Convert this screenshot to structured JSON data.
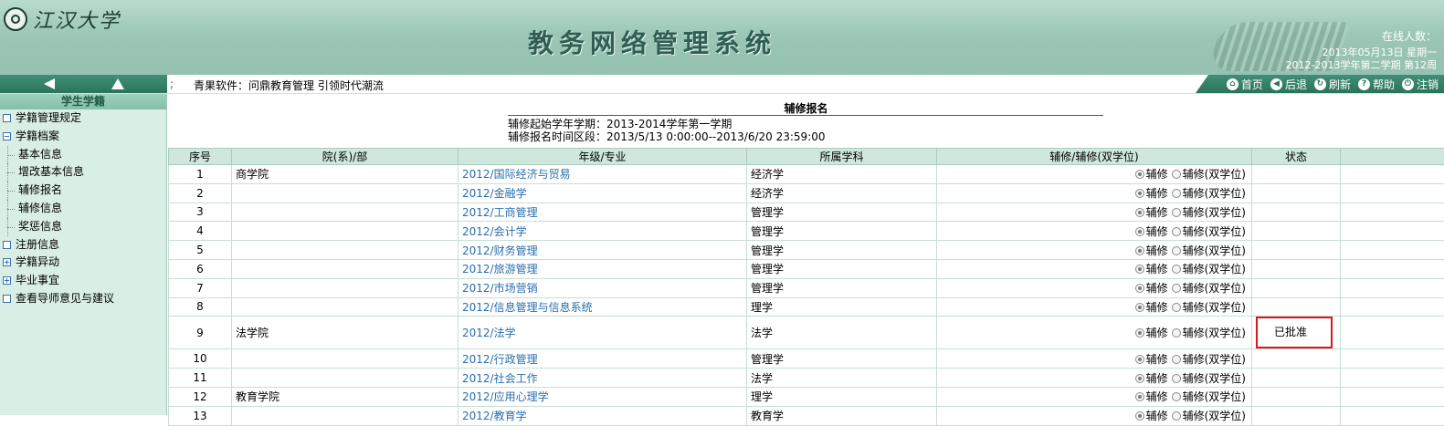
{
  "header": {
    "logo_text": "江汉大学",
    "system_title": "教务网络管理系统",
    "online_label": "在线人数：",
    "date": "2013年05月13日 星期一",
    "term": "2012-2013学年第二学期 第12周"
  },
  "toolbar": {
    "separator": ";",
    "slogan": "青果软件：问鼎教育管理 引领时代潮流",
    "links": {
      "home": "首页",
      "back": "后退",
      "refresh": "刷新",
      "help": "帮助",
      "logout": "注销"
    }
  },
  "sidebar": {
    "title": "学生学籍",
    "items": {
      "rules": "学籍管理规定",
      "archive": "学籍档案",
      "basic_info": "基本信息",
      "edit_basic_info": "增改基本信息",
      "minor_signup": "辅修报名",
      "minor_info": "辅修信息",
      "rewards": "奖惩信息",
      "registration": "注册信息",
      "status_change": "学籍异动",
      "graduation": "毕业事宜",
      "advisor_feedback": "查看导师意见与建议"
    }
  },
  "main": {
    "form_title": "辅修报名",
    "start_term": "辅修起始学年学期：2013-2014学年第一学期",
    "signup_period": "辅修报名时间区段：2013/5/13 0:00:00--2013/6/20 23:59:00",
    "columns": {
      "index": "序号",
      "department": "院(系)/部",
      "major": "年级/专业",
      "discipline": "所属学科",
      "option": "辅修/辅修(双学位)",
      "status": "状态"
    },
    "option_labels": {
      "minor": "辅修",
      "double_degree": "辅修(双学位)"
    },
    "rows": [
      {
        "index": "1",
        "department": "商学院",
        "major": "2012/国际经济与贸易",
        "discipline": "经济学",
        "status": ""
      },
      {
        "index": "2",
        "department": "",
        "major": "2012/金融学",
        "discipline": "经济学",
        "status": ""
      },
      {
        "index": "3",
        "department": "",
        "major": "2012/工商管理",
        "discipline": "管理学",
        "status": ""
      },
      {
        "index": "4",
        "department": "",
        "major": "2012/会计学",
        "discipline": "管理学",
        "status": ""
      },
      {
        "index": "5",
        "department": "",
        "major": "2012/财务管理",
        "discipline": "管理学",
        "status": ""
      },
      {
        "index": "6",
        "department": "",
        "major": "2012/旅游管理",
        "discipline": "管理学",
        "status": ""
      },
      {
        "index": "7",
        "department": "",
        "major": "2012/市场营销",
        "discipline": "管理学",
        "status": ""
      },
      {
        "index": "8",
        "department": "",
        "major": "2012/信息管理与信息系统",
        "discipline": "理学",
        "status": ""
      },
      {
        "index": "9",
        "department": "法学院",
        "major": "2012/法学",
        "discipline": "法学",
        "status": "已批准"
      },
      {
        "index": "10",
        "department": "",
        "major": "2012/行政管理",
        "discipline": "管理学",
        "status": ""
      },
      {
        "index": "11",
        "department": "",
        "major": "2012/社会工作",
        "discipline": "法学",
        "status": ""
      },
      {
        "index": "12",
        "department": "教育学院",
        "major": "2012/应用心理学",
        "discipline": "理学",
        "status": ""
      },
      {
        "index": "13",
        "department": "",
        "major": "2012/教育学",
        "discipline": "教育学",
        "status": ""
      }
    ]
  }
}
